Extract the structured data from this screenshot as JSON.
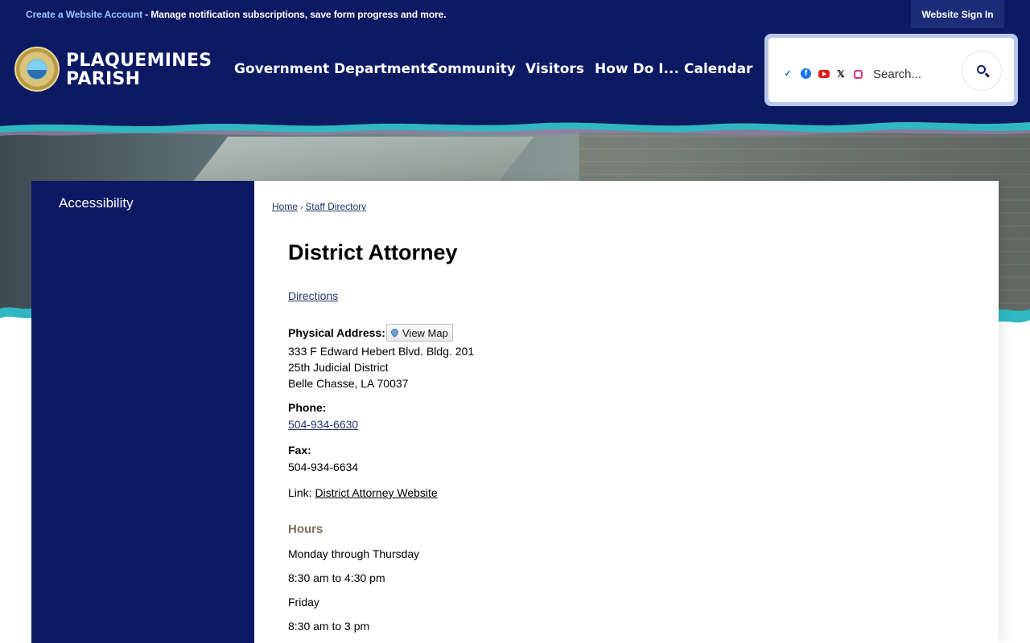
{
  "topbar": {
    "create_account": "Create a Website Account",
    "notice_text": " - Manage notification subscriptions, save form progress and more.",
    "sign_in": "Website Sign In"
  },
  "header": {
    "brand_line1": "PLAQUEMINES",
    "brand_line2": "PARISH",
    "nav": [
      "Government Departments",
      "Community",
      "Visitors",
      "How Do I...",
      "Calendar"
    ],
    "social_icons": [
      "nextdoor-icon",
      "facebook-icon",
      "youtube-icon",
      "x-icon",
      "instagram-icon"
    ],
    "search_placeholder": "Search..."
  },
  "sidebar": {
    "items": [
      "Accessibility"
    ]
  },
  "breadcrumb": [
    "Home",
    "Staff Directory"
  ],
  "page": {
    "title": "District Attorney",
    "directions": "Directions",
    "physical_address_label": "Physical Address:",
    "view_map": "View Map",
    "address": [
      "333 F Edward Hebert Blvd. Bldg. 201",
      "25th Judicial District",
      "Belle Chasse, LA 70037"
    ],
    "phone_label": "Phone:",
    "phone": "504-934-6630",
    "fax_label": "Fax:",
    "fax": "504-934-6634",
    "link_label": "Link: ",
    "link_text": "District Attorney Website",
    "hours_heading": "Hours",
    "hours": [
      "Monday through Thursday",
      "8:30 am to 4:30 pm",
      "Friday",
      "8:30 am to 3 pm"
    ]
  },
  "colors": {
    "navy": "#0c1a63",
    "teal_wave": "#2fb8c2",
    "link": "#1f3568",
    "hours_heading": "#7a7255"
  }
}
